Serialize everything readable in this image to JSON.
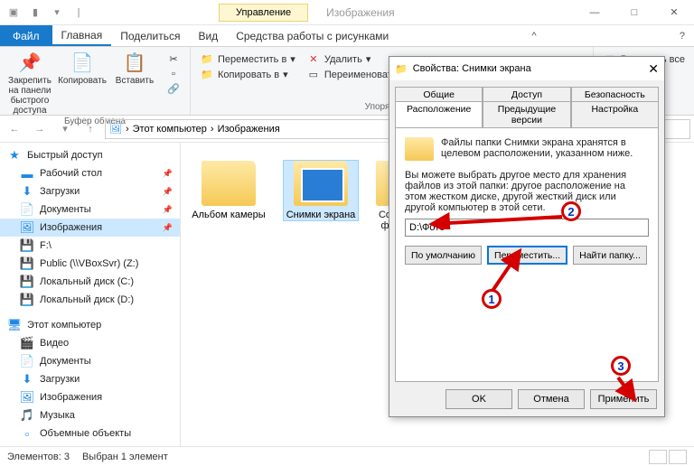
{
  "window": {
    "section_tab": "Управление",
    "app_title": "Изображения"
  },
  "ribbon_tabs": {
    "file": "Файл",
    "tabs": [
      "Главная",
      "Поделиться",
      "Вид",
      "Средства работы с рисунками"
    ]
  },
  "ribbon": {
    "clipboard": {
      "pin": "Закрепить на панели быстрого доступа",
      "copy": "Копировать",
      "paste": "Вставить",
      "label": "Буфер обмена"
    },
    "organize": {
      "move": "Переместить в",
      "copy_to": "Копировать в",
      "delete": "Удалить",
      "rename": "Переименовать",
      "label": "Упорядочить"
    },
    "select": {
      "select_all": "Выделить все"
    }
  },
  "addr": {
    "crumbs": [
      "Этот компьютер",
      "Изображения"
    ]
  },
  "sidebar": {
    "quick": "Быстрый доступ",
    "items": [
      "Рабочий стол",
      "Загрузки",
      "Документы",
      "Изображения",
      "F:\\",
      "Public (\\\\VBoxSvr) (Z:)",
      "Локальный диск (C:)",
      "Локальный диск (D:)"
    ],
    "pc": "Этот компьютер",
    "pc_items": [
      "Видео",
      "Документы",
      "Загрузки",
      "Изображения",
      "Музыка",
      "Объемные объекты"
    ]
  },
  "content": {
    "folders": [
      "Альбом камеры",
      "Снимки экрана"
    ],
    "folder3": "Со\nф"
  },
  "status": {
    "count": "Элементов: 3",
    "selected": "Выбран 1 элемент"
  },
  "dialog": {
    "title": "Свойства: Снимки экрана",
    "tabs_top": [
      "Общие",
      "Доступ",
      "Безопасность"
    ],
    "tabs_bot": [
      "Расположение",
      "Предыдущие версии",
      "Настройка"
    ],
    "info1": "Файлы папки Снимки экрана хранятся в целевом расположении, указанном ниже.",
    "info2": "Вы можете выбрать другое место для хранения файлов из этой папки: другое расположение на этом жестком диске, другой жесткий диск или другой компьютер в этой сети.",
    "path": "D:\\Фото",
    "btn_default": "По умолчанию",
    "btn_move": "Переместить...",
    "btn_find": "Найти папку...",
    "ok": "OK",
    "cancel": "Отмена",
    "apply": "Применить"
  },
  "anno": {
    "n1": "1",
    "n2": "2",
    "n3": "3"
  }
}
